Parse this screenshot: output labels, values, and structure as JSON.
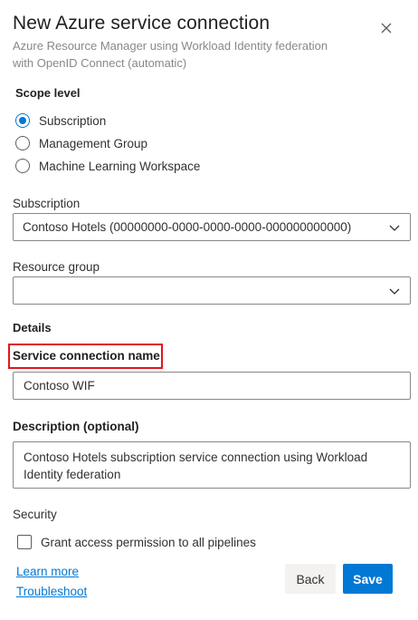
{
  "header": {
    "title": "New Azure service connection",
    "subtitle_line1": "Azure Resource Manager using Workload Identity federation",
    "subtitle_line2": "with OpenID Connect (automatic)"
  },
  "scope": {
    "label": "Scope level",
    "options": [
      {
        "label": "Subscription",
        "selected": true
      },
      {
        "label": "Management Group",
        "selected": false
      },
      {
        "label": "Machine Learning Workspace",
        "selected": false
      }
    ]
  },
  "subscription": {
    "label": "Subscription",
    "value": "Contoso Hotels (00000000-0000-0000-0000-000000000000)"
  },
  "resource_group": {
    "label": "Resource group",
    "value": ""
  },
  "details": {
    "label": "Details",
    "connection_name_label": "Service connection name",
    "connection_name_value": "Contoso WIF",
    "description_label": "Description (optional)",
    "description_line1": "Contoso Hotels subscription service connection using Workload",
    "description_line2": "Identity federation"
  },
  "security": {
    "label": "Security",
    "grant_access_label": "Grant access permission to all pipelines",
    "grant_access_checked": false
  },
  "footer": {
    "learn_more": "Learn more",
    "troubleshoot": "Troubleshoot",
    "back_label": "Back",
    "save_label": "Save"
  },
  "colors": {
    "accent": "#0078d4",
    "highlight": "#e0161e"
  }
}
